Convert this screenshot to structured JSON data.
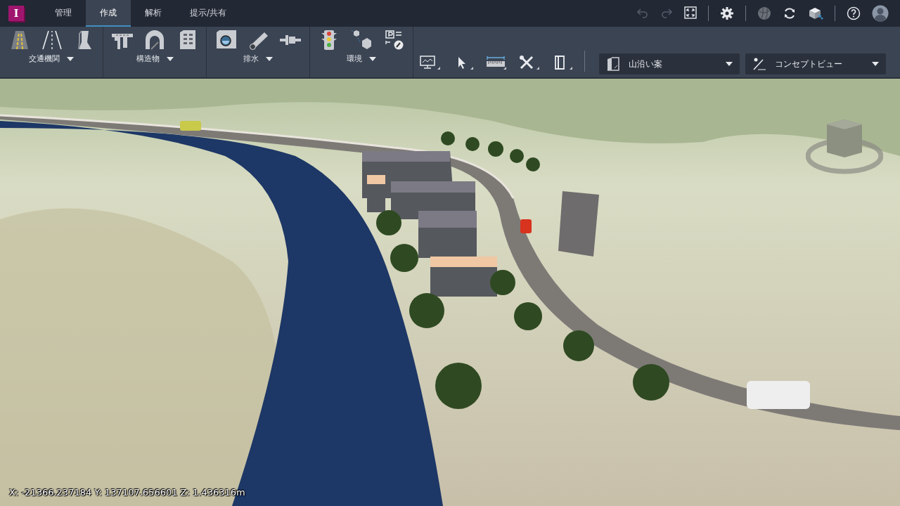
{
  "app": {
    "logo": "I"
  },
  "tabs": [
    {
      "label": "管理",
      "selected": false
    },
    {
      "label": "作成",
      "selected": true
    },
    {
      "label": "解析",
      "selected": false
    },
    {
      "label": "提示/共有",
      "selected": false
    }
  ],
  "title_actions": [
    {
      "kind": "undo",
      "disabled": true
    },
    {
      "kind": "redo",
      "disabled": true
    },
    {
      "kind": "fit",
      "disabled": false
    }
  ],
  "ribbon_groups": [
    {
      "label": "交通機関"
    },
    {
      "label": "構造物"
    },
    {
      "label": "排水"
    },
    {
      "label": "環境"
    }
  ],
  "proposal": {
    "value": "山沿い案"
  },
  "view_style": {
    "value": "コンセプトビュー"
  },
  "status_bar": {
    "coordinates": "X: -21366.237184 Y: 137107.656601 Z: 1.436316m"
  }
}
